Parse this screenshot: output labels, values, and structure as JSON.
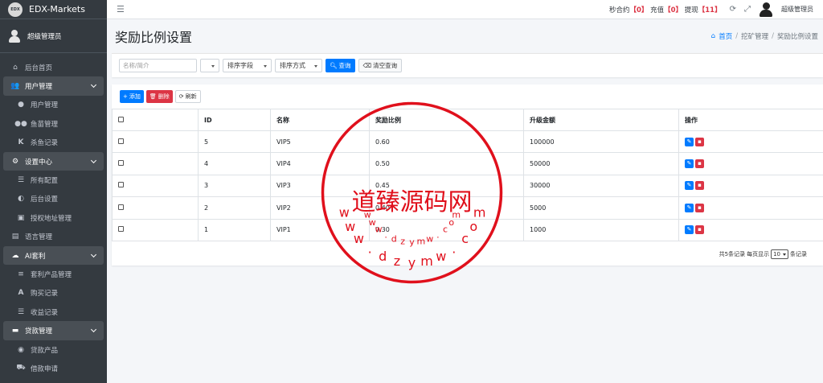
{
  "brand": {
    "logo_text": "EDX",
    "name": "EDX-Markets"
  },
  "user": {
    "name": "超级管理员"
  },
  "sidebar": {
    "items": [
      {
        "label": "后台首页",
        "icon": "home-icon",
        "kind": "top"
      },
      {
        "label": "用户管理",
        "icon": "users-icon",
        "kind": "group"
      },
      {
        "label": "用户管理",
        "icon": "user-icon",
        "kind": "sub"
      },
      {
        "label": "鱼苗管理",
        "icon": "users-icon",
        "kind": "sub"
      },
      {
        "label": "杀鱼记录",
        "icon": "k-icon",
        "kind": "sub"
      },
      {
        "label": "设置中心",
        "icon": "cogs-icon",
        "kind": "group"
      },
      {
        "label": "所有配置",
        "icon": "list-icon",
        "kind": "sub"
      },
      {
        "label": "后台设置",
        "icon": "contrast-icon",
        "kind": "sub"
      },
      {
        "label": "授权地址管理",
        "icon": "address-card-icon",
        "kind": "sub"
      },
      {
        "label": "语言管理",
        "icon": "language-icon",
        "kind": "top"
      },
      {
        "label": "AI套利",
        "icon": "cloud-icon",
        "kind": "group"
      },
      {
        "label": "套利产品管理",
        "icon": "bars-icon",
        "kind": "sub"
      },
      {
        "label": "购买记录",
        "icon": "font-icon",
        "kind": "sub"
      },
      {
        "label": "收益记录",
        "icon": "list-icon",
        "kind": "sub"
      },
      {
        "label": "贷款管理",
        "icon": "money-icon",
        "kind": "group"
      },
      {
        "label": "贷款产品",
        "icon": "product-icon",
        "kind": "sub"
      },
      {
        "label": "借款申请",
        "icon": "truck-icon",
        "kind": "sub"
      }
    ]
  },
  "navbar": {
    "stat1_label": "秒合约",
    "stat1_value": "【0】",
    "stat2_label": "充值",
    "stat2_value": "【0】",
    "stat3_label": "提现",
    "stat3_value": "【11】",
    "user_name": "超级管理员"
  },
  "header": {
    "title": "奖励比例设置",
    "breadcrumb_home": "首页",
    "breadcrumb_2": "挖矿管理",
    "breadcrumb_3": "奖励比例设置"
  },
  "filter": {
    "search_placeholder": "名称/简介",
    "sort_field_label": "排序字段",
    "sort_order_label": "排序方式",
    "query_label": "查询",
    "clear_label": "清空查询"
  },
  "toolbar": {
    "add_label": "添加",
    "delete_label": "删除",
    "refresh_label": "刷新"
  },
  "table": {
    "columns": [
      "ID",
      "名称",
      "奖励比例",
      "升级金额",
      "操作"
    ],
    "rows": [
      {
        "id": "5",
        "name": "VIP5",
        "ratio": "0.60",
        "amount": "100000"
      },
      {
        "id": "4",
        "name": "VIP4",
        "ratio": "0.50",
        "amount": "50000"
      },
      {
        "id": "3",
        "name": "VIP3",
        "ratio": "0.45",
        "amount": "30000"
      },
      {
        "id": "2",
        "name": "VIP2",
        "ratio": "0.40",
        "amount": "5000"
      },
      {
        "id": "1",
        "name": "VIP1",
        "ratio": "0.30",
        "amount": "1000"
      }
    ]
  },
  "pagination": {
    "total_text": "共5条记录",
    "per_page_label": "每页显示",
    "per_page_value": "10",
    "suffix": "条记录"
  },
  "watermark": {
    "center_text": "道臻源码网",
    "top_chars": [
      "w",
      "w",
      "w",
      ".",
      "d",
      "z",
      "y",
      "m",
      "w",
      ".",
      "c",
      "o",
      "m"
    ],
    "bottom_chars": [
      "w",
      "w",
      "w",
      ".",
      "d",
      "z",
      "y",
      "m",
      "w",
      ".",
      "c",
      "o",
      "m"
    ]
  },
  "colors": {
    "primary": "#007bff",
    "danger": "#dc3545",
    "sidebar": "#343a40",
    "watermark": "#e0101c"
  }
}
